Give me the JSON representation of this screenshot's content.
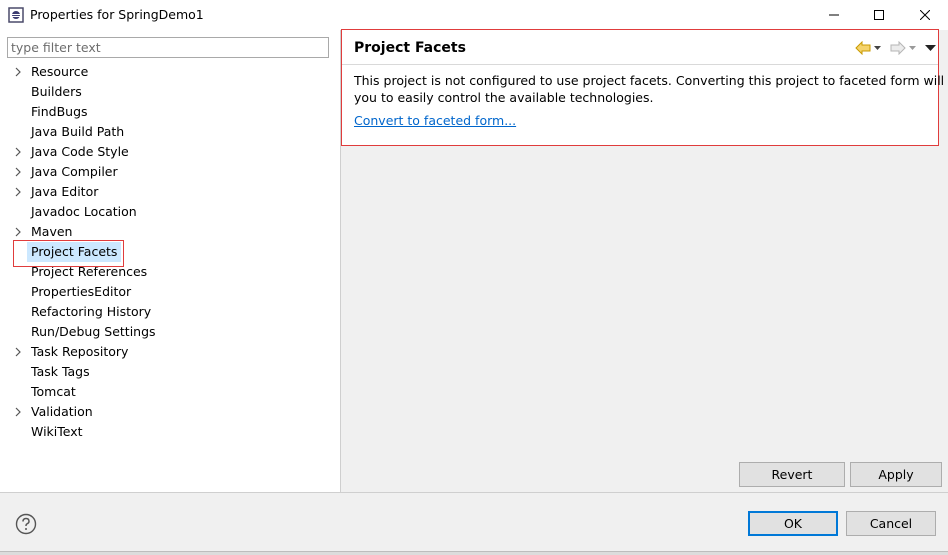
{
  "window": {
    "title": "Properties for SpringDemo1",
    "minimize_icon": "minimize-icon",
    "maximize_icon": "maximize-icon",
    "close_icon": "close-icon"
  },
  "filter": {
    "placeholder": "type filter text",
    "value": ""
  },
  "tree": {
    "items": [
      {
        "label": "Resource",
        "expandable": true
      },
      {
        "label": "Builders",
        "expandable": false
      },
      {
        "label": "FindBugs",
        "expandable": false
      },
      {
        "label": "Java Build Path",
        "expandable": false
      },
      {
        "label": "Java Code Style",
        "expandable": true
      },
      {
        "label": "Java Compiler",
        "expandable": true
      },
      {
        "label": "Java Editor",
        "expandable": true
      },
      {
        "label": "Javadoc Location",
        "expandable": false
      },
      {
        "label": "Maven",
        "expandable": true
      },
      {
        "label": "Project Facets",
        "expandable": false,
        "selected": true
      },
      {
        "label": "Project References",
        "expandable": false
      },
      {
        "label": "PropertiesEditor",
        "expandable": false
      },
      {
        "label": "Refactoring History",
        "expandable": false
      },
      {
        "label": "Run/Debug Settings",
        "expandable": false
      },
      {
        "label": "Task Repository",
        "expandable": true
      },
      {
        "label": "Task Tags",
        "expandable": false
      },
      {
        "label": "Tomcat",
        "expandable": false
      },
      {
        "label": "Validation",
        "expandable": true
      },
      {
        "label": "WikiText",
        "expandable": false
      }
    ]
  },
  "page": {
    "title": "Project Facets",
    "description_line1": "This project is not configured to use project facets. Converting this project to faceted form will allow",
    "description_line2": "you to easily control the available technologies.",
    "link": "Convert to faceted form..."
  },
  "buttons": {
    "revert": "Revert",
    "apply": "Apply",
    "ok": "OK",
    "cancel": "Cancel"
  },
  "colors": {
    "highlight_frame": "#e03c3c",
    "selection": "#cce8ff",
    "link": "#0066cc",
    "back_arrow": "#e8b400"
  }
}
